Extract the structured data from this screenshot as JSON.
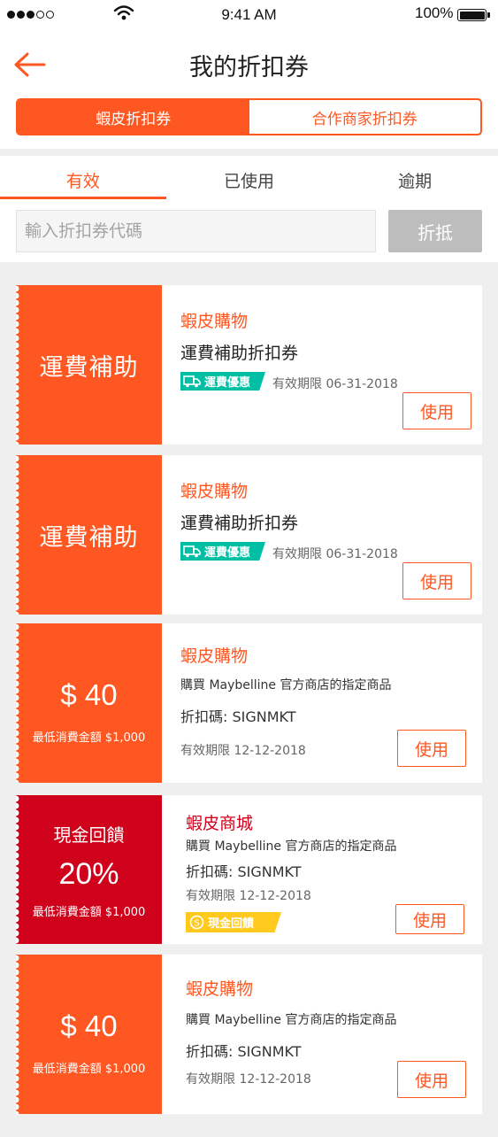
{
  "status_bar": {
    "time": "9:41 AM",
    "battery": "100%"
  },
  "header": {
    "title": "我的折扣券"
  },
  "segments": [
    "蝦皮折扣券",
    "合作商家折扣券"
  ],
  "tabs": [
    "有效",
    "已使用",
    "逾期"
  ],
  "code_input": {
    "placeholder": "輸入折扣券代碼",
    "value": ""
  },
  "redeem_label": "折抵",
  "icons": {
    "back": "arrow-left-icon",
    "wifi": "wifi-icon",
    "battery": "battery-icon",
    "truck": "truck-icon",
    "coin": "coin-icon"
  },
  "colors": {
    "accent": "#fe5722",
    "mall_red": "#d0011b",
    "shipping_green": "#00bfa5",
    "cashback_yellow": "#ffc91d",
    "redeem_disabled": "#bdbdbd"
  },
  "vouchers": [
    {
      "left_label": "運費補助",
      "shop": "蝦皮購物",
      "name": "運費補助折扣券",
      "badge": "運費優惠",
      "expiry": "有效期限 06-31-2018",
      "button": "使用"
    },
    {
      "left_label": "運費補助",
      "shop": "蝦皮購物",
      "name": "運費補助折扣券",
      "badge": "運費優惠",
      "expiry": "有效期限 06-31-2018",
      "button": "使用"
    },
    {
      "amount": "$ 40",
      "min_spend": "最低消費金額 $1,000",
      "shop": "蝦皮購物",
      "desc": "購買 Maybelline 官方商店的指定商品",
      "code": "折扣碼: SIGNMKT",
      "expiry": "有效期限 12-12-2018",
      "button": "使用"
    },
    {
      "left_label": "現金回饋",
      "percent": "20%",
      "min_spend": "最低消費金額 $1,000",
      "shop": "蝦皮商城",
      "desc": "購買 Maybelline 官方商店的指定商品",
      "code": "折扣碼: SIGNMKT",
      "expiry": "有效期限 12-12-2018",
      "badge": "現金回饋",
      "button": "使用"
    },
    {
      "amount": "$ 40",
      "min_spend": "最低消費金額 $1,000",
      "shop": "蝦皮購物",
      "desc": "購買 Maybelline 官方商店的指定商品",
      "code": "折扣碼: SIGNMKT",
      "expiry": "有效期限 12-12-2018",
      "button": "使用"
    }
  ]
}
